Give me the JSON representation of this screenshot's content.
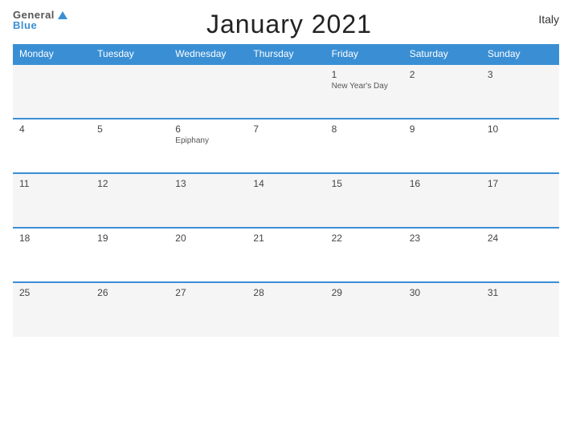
{
  "header": {
    "title": "January 2021",
    "country": "Italy"
  },
  "logo": {
    "general": "General",
    "blue": "Blue"
  },
  "columns": [
    "Monday",
    "Tuesday",
    "Wednesday",
    "Thursday",
    "Friday",
    "Saturday",
    "Sunday"
  ],
  "weeks": [
    [
      {
        "day": "",
        "holiday": ""
      },
      {
        "day": "",
        "holiday": ""
      },
      {
        "day": "",
        "holiday": ""
      },
      {
        "day": "",
        "holiday": ""
      },
      {
        "day": "1",
        "holiday": "New Year's Day"
      },
      {
        "day": "2",
        "holiday": ""
      },
      {
        "day": "3",
        "holiday": ""
      }
    ],
    [
      {
        "day": "4",
        "holiday": ""
      },
      {
        "day": "5",
        "holiday": ""
      },
      {
        "day": "6",
        "holiday": "Epiphany"
      },
      {
        "day": "7",
        "holiday": ""
      },
      {
        "day": "8",
        "holiday": ""
      },
      {
        "day": "9",
        "holiday": ""
      },
      {
        "day": "10",
        "holiday": ""
      }
    ],
    [
      {
        "day": "11",
        "holiday": ""
      },
      {
        "day": "12",
        "holiday": ""
      },
      {
        "day": "13",
        "holiday": ""
      },
      {
        "day": "14",
        "holiday": ""
      },
      {
        "day": "15",
        "holiday": ""
      },
      {
        "day": "16",
        "holiday": ""
      },
      {
        "day": "17",
        "holiday": ""
      }
    ],
    [
      {
        "day": "18",
        "holiday": ""
      },
      {
        "day": "19",
        "holiday": ""
      },
      {
        "day": "20",
        "holiday": ""
      },
      {
        "day": "21",
        "holiday": ""
      },
      {
        "day": "22",
        "holiday": ""
      },
      {
        "day": "23",
        "holiday": ""
      },
      {
        "day": "24",
        "holiday": ""
      }
    ],
    [
      {
        "day": "25",
        "holiday": ""
      },
      {
        "day": "26",
        "holiday": ""
      },
      {
        "day": "27",
        "holiday": ""
      },
      {
        "day": "28",
        "holiday": ""
      },
      {
        "day": "29",
        "holiday": ""
      },
      {
        "day": "30",
        "holiday": ""
      },
      {
        "day": "31",
        "holiday": ""
      }
    ]
  ]
}
